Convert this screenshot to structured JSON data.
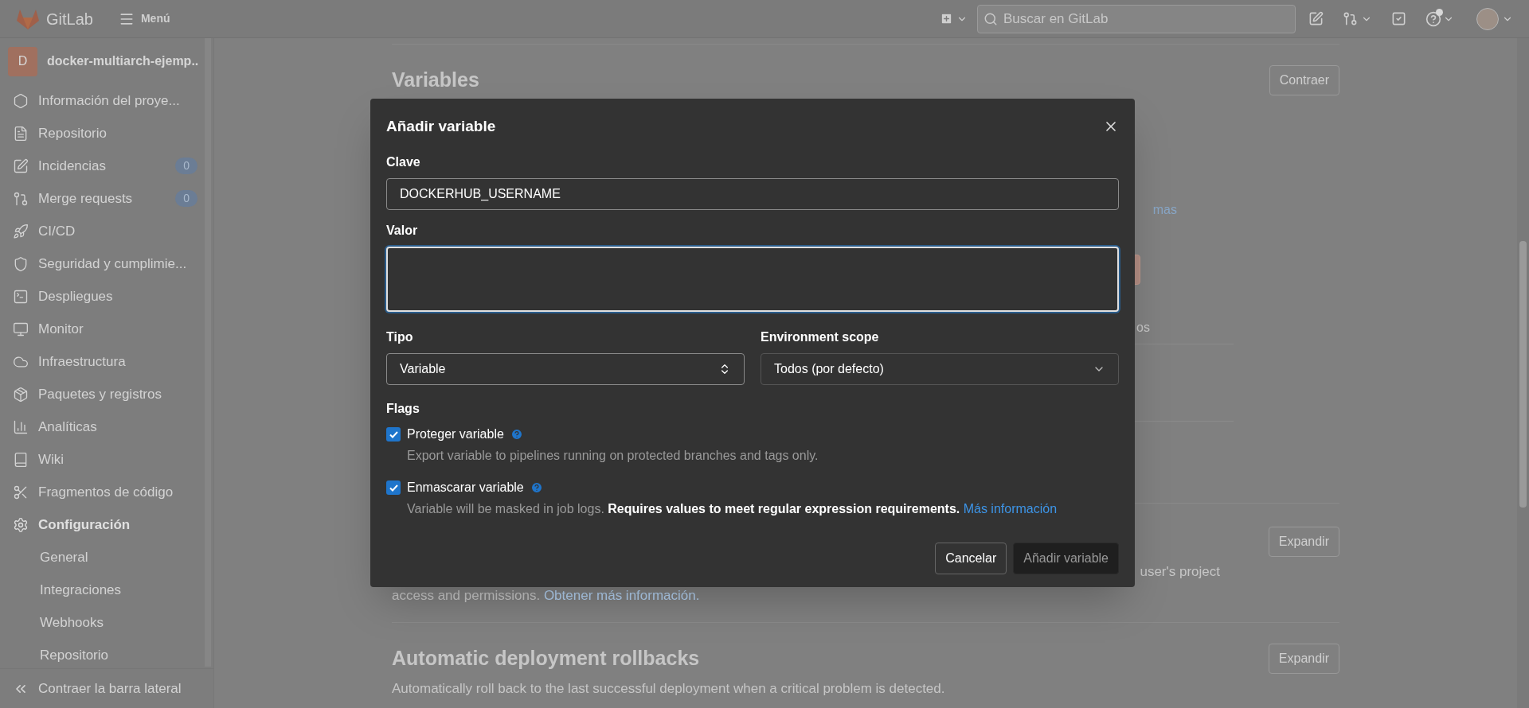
{
  "top_bar": {
    "brand": "GitLab",
    "menu": "Menú",
    "search": {
      "placeholder": "Buscar en GitLab"
    }
  },
  "sidebar": {
    "project": {
      "initial": "D",
      "name": "docker-multiarch-ejemp.."
    },
    "items": [
      {
        "label": "Información del proye...",
        "selected": false
      },
      {
        "label": "Repositorio",
        "selected": false
      },
      {
        "label": "Incidencias",
        "badge": "0",
        "selected": false
      },
      {
        "label": "Merge requests",
        "badge": "0",
        "selected": false
      },
      {
        "label": "CI/CD",
        "selected": false
      },
      {
        "label": "Seguridad y cumplimie...",
        "selected": false
      },
      {
        "label": "Despliegues",
        "selected": false
      },
      {
        "label": "Monitor",
        "selected": false
      },
      {
        "label": "Infraestructura",
        "selected": false
      },
      {
        "label": "Paquetes y registros",
        "selected": false
      },
      {
        "label": "Analíticas",
        "selected": false
      },
      {
        "label": "Wiki",
        "selected": false
      },
      {
        "label": "Fragmentos de código",
        "selected": false
      },
      {
        "label": "Configuración",
        "selected": true,
        "children": [
          {
            "label": "General"
          },
          {
            "label": "Integraciones"
          },
          {
            "label": "Webhooks"
          },
          {
            "label": "Repositorio"
          }
        ]
      }
    ],
    "collapse": "Contraer la barra lateral"
  },
  "page": {
    "sections": [
      {
        "title": "Variables",
        "button": "Contraer",
        "fragments": {
          "link": "mas",
          "tail": "os"
        }
      },
      {
        "button": "Expandir",
        "line_end": "user's project",
        "line_start": "access and permissions.",
        "link": "Obtener más información."
      },
      {
        "title": "Automatic deployment rollbacks",
        "button": "Expandir",
        "description": "Automatically roll back to the last successful deployment when a critical problem is detected."
      }
    ]
  },
  "dialog": {
    "title": "Añadir variable",
    "key": {
      "label": "Clave",
      "value": "DOCKERHUB_USERNAME"
    },
    "value": {
      "label": "Valor",
      "focused": true
    },
    "type": {
      "label": "Tipo",
      "value": "Variable"
    },
    "scope": {
      "label": "Environment scope",
      "value": "Todos (por defecto)"
    },
    "flags_label": "Flags",
    "flags": [
      {
        "label": "Proteger variable",
        "checked": true,
        "description": "Export variable to pipelines running on protected branches and tags only."
      },
      {
        "label": "Enmascarar variable",
        "checked": true,
        "description": "Variable will be masked in job logs. **Requires values to meet regular expression requirements.**",
        "link": "Más información"
      }
    ],
    "cancel": "Cancelar",
    "submit": {
      "label": "Añadir variable",
      "disabled": true
    }
  }
}
